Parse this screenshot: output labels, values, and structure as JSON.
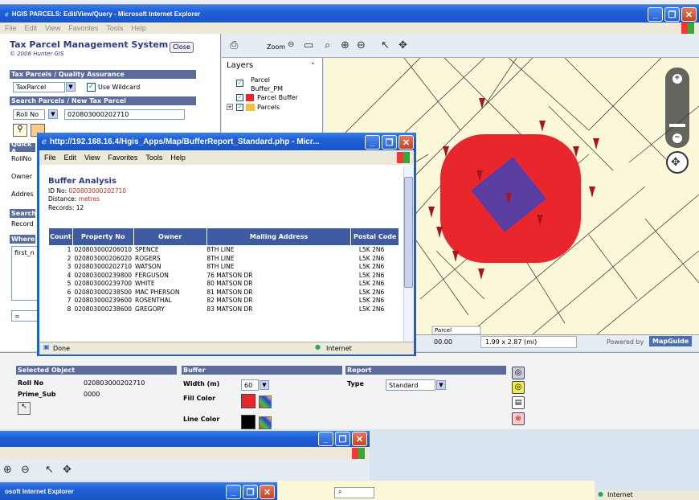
{
  "main_window": {
    "title": "HGIS PARCELS: Edit/View/Query - Microsoft Internet Explorer",
    "menu": [
      "File",
      "Edit",
      "View",
      "Favorites",
      "Tools",
      "Help"
    ]
  },
  "app": {
    "title": "Tax Parcel Management System",
    "copyright": "© 2006 Hunter GIS",
    "close_label": "Close"
  },
  "qa": {
    "header": "Tax Parcels / Quality Assurance",
    "layer_value": "TaxParcel",
    "wildcard_label": "Use Wildcard"
  },
  "search": {
    "header": "Search Parcels / New Tax Parcel",
    "field": "Roll No",
    "value": "020803000202710"
  },
  "left_labels": {
    "quick": "Quick A",
    "rollno": "RollNo",
    "owner": "Owner",
    "address": "Addres",
    "search": "Search",
    "records": "Record",
    "where": "Where",
    "first": "first_n",
    "eq": "="
  },
  "toolbar": {
    "zoom_label": "Zoom"
  },
  "layers": {
    "title": "Layers",
    "items": [
      {
        "label": "Parcel"
      },
      {
        "label": "Buffer_PM"
      },
      {
        "label": "Parcel Buffer"
      },
      {
        "label": "Parcels"
      }
    ]
  },
  "map": {
    "scale": "1.99 x 2.87 (mi)",
    "coord": "00.00",
    "powered": "Powered by",
    "brand": "MapGuide",
    "parcel_tag": "Parcel",
    "colors": {
      "buffer": "#e8262c",
      "selected": "#5a3fa0"
    }
  },
  "popup": {
    "title": "http://192.168.16.4/Hgis_Apps/Map/BufferReport_Standard.php - Micr...",
    "menu": [
      "File",
      "Edit",
      "View",
      "Favorites",
      "Tools",
      "Help"
    ],
    "heading": "Buffer Analysis",
    "id_label": "ID No:",
    "id_value": "020803000202710",
    "distance_label": "Distance:",
    "distance_value": "metres",
    "records_label": "Records:",
    "records_value": "12",
    "columns": [
      "Count",
      "Property No",
      "Owner",
      "Mailing Address",
      "Postal Code"
    ],
    "rows": [
      [
        "1",
        "020803000206010",
        "SPENCE",
        "8TH LINE",
        "L5K 2N6"
      ],
      [
        "2",
        "020803000206020",
        "ROGERS",
        "8TH LINE",
        "L5K 2N6"
      ],
      [
        "3",
        "020803000202710",
        "WATSON",
        "8TH LINE",
        "L5K 2N6"
      ],
      [
        "4",
        "020803000239800",
        "FERGUSON",
        "76 MATSON DR",
        "L5K 2N6"
      ],
      [
        "5",
        "020803000239700",
        "WHITE",
        "80 MATSON DR",
        "L5K 2N6"
      ],
      [
        "6",
        "020803000238500",
        "MAC PHERSON",
        "81 MATSON DR",
        "L5K 2N6"
      ],
      [
        "7",
        "020803000239600",
        "ROSENTHAL",
        "82 MATSON DR",
        "L5K 2N6"
      ],
      [
        "8",
        "020803000238600",
        "GREGORY",
        "83 MATSON DR",
        "L5K 2N6"
      ]
    ],
    "status_done": "Done",
    "status_zone": "Internet"
  },
  "selected": {
    "header": "Selected Object",
    "roll_label": "Roll No",
    "roll_value": "020803000202710",
    "prime_label": "Prime_Sub",
    "prime_value": "0000"
  },
  "buffer": {
    "header": "Buffer",
    "width_label": "Width (m)",
    "width_value": "60",
    "fill_label": "Fill Color",
    "line_label": "Line Color",
    "fill_color": "#e8262c",
    "line_color": "#000000"
  },
  "report": {
    "header": "Report",
    "type_label": "Type",
    "type_value": "Standard"
  },
  "bottom": {
    "window_title": "osoft Internet Explorer",
    "status_zone": "Internet"
  }
}
